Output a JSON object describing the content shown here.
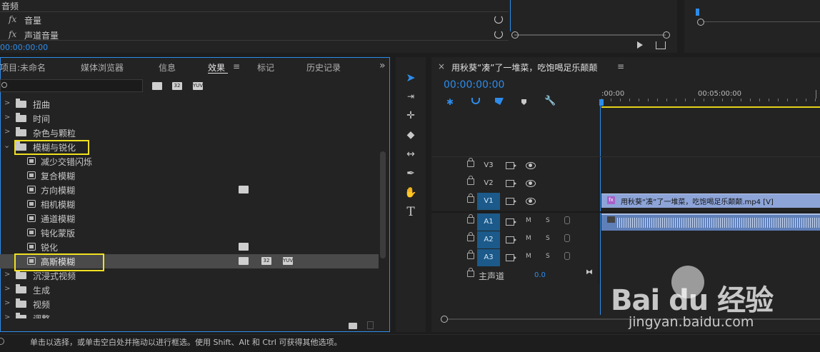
{
  "top_panel": {
    "section_label": "音频",
    "rows": [
      {
        "fx": "fx",
        "label": "音量"
      },
      {
        "fx": "fx",
        "label": "声道音量"
      }
    ],
    "timecode": "00:00:00:00"
  },
  "project_panel": {
    "tabs": [
      "项目:未命名",
      "媒体浏览器",
      "信息",
      "效果",
      "标记",
      "历史记录"
    ],
    "active_tab": "效果",
    "menu_glyph": "≡",
    "overflow_glyph": "»",
    "search_placeholder": "",
    "filter_badges": [
      "32",
      "YUV"
    ],
    "tree": [
      {
        "label": "扭曲",
        "type": "folder",
        "expanded": false
      },
      {
        "label": "时间",
        "type": "folder",
        "expanded": false
      },
      {
        "label": "杂色与颗粒",
        "type": "folder",
        "expanded": false
      },
      {
        "label": "模糊与锐化",
        "type": "folder",
        "expanded": true
      },
      {
        "label": "减少交错闪烁",
        "type": "effect"
      },
      {
        "label": "复合模糊",
        "type": "effect"
      },
      {
        "label": "方向模糊",
        "type": "effect"
      },
      {
        "label": "相机模糊",
        "type": "effect"
      },
      {
        "label": "通道模糊",
        "type": "effect"
      },
      {
        "label": "钝化蒙版",
        "type": "effect"
      },
      {
        "label": "锐化",
        "type": "effect"
      },
      {
        "label": "高斯模糊",
        "type": "effect",
        "selected": true
      },
      {
        "label": "沉浸式视频",
        "type": "folder",
        "expanded": false
      },
      {
        "label": "生成",
        "type": "folder",
        "expanded": false
      },
      {
        "label": "视频",
        "type": "folder",
        "expanded": false
      },
      {
        "label": "调整",
        "type": "folder",
        "expanded": false
      }
    ]
  },
  "timeline": {
    "close_glyph": "×",
    "sequence_title": "用秋葵“凑”了一堆菜，吃饱喝足乐颠颠",
    "menu_glyph": "≡",
    "timecode": "00:00:00:00",
    "ruler_labels": [
      ":00:00",
      "00:05:00:00"
    ],
    "tracks": [
      {
        "name": "V3",
        "kind": "video",
        "active": false
      },
      {
        "name": "V2",
        "kind": "video",
        "active": false
      },
      {
        "name": "V1",
        "kind": "video",
        "active": true
      },
      {
        "name": "A1",
        "kind": "audio",
        "active": true
      },
      {
        "name": "A2",
        "kind": "audio",
        "active": true
      },
      {
        "name": "A3",
        "kind": "audio",
        "active": true
      }
    ],
    "mute_label": "M",
    "solo_label": "S",
    "master_label": "主声道",
    "master_value": "0.0",
    "video_clip_label": "用秋葵“凑”了一堆菜，吃饱喝足乐颠颠.mp4 [V]",
    "clip_fx_badge": "fx"
  },
  "status_bar": {
    "text": "单击以选择，或单击空白处并拖动以进行框选。使用 Shift、Alt 和 Ctrl 可获得其他选项。"
  },
  "watermark": {
    "brand": "Bai du 经验",
    "url": "jingyan.baidu.com"
  },
  "colors": {
    "accent_blue": "#2d8ceb",
    "highlight_yellow": "#f0e020",
    "video_clip": "#8da4d8",
    "audio_clip": "#5f7fb8"
  }
}
